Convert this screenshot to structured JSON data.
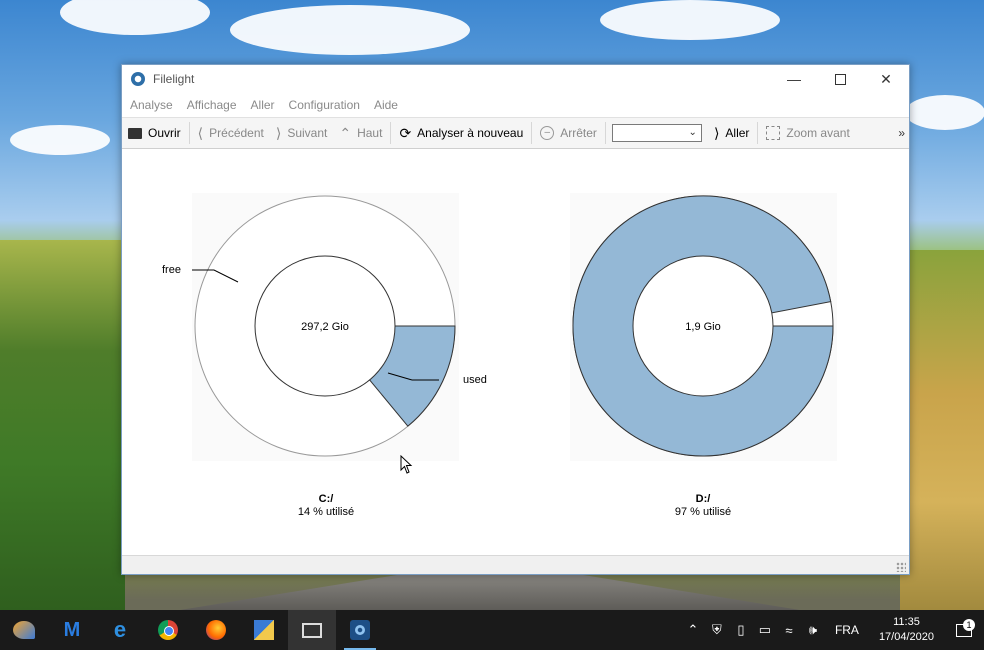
{
  "window": {
    "title": "Filelight"
  },
  "menu": [
    "Analyse",
    "Affichage",
    "Aller",
    "Configuration",
    "Aide"
  ],
  "toolbar": {
    "open": "Ouvrir",
    "back": "Précédent",
    "forward": "Suivant",
    "up": "Haut",
    "rescan": "Analyser à nouveau",
    "stop": "Arrêter",
    "location_value": "",
    "go": "Aller",
    "zoom_in": "Zoom avant",
    "more": "»"
  },
  "drives": [
    {
      "name": "C:/",
      "size": "297,2 Gio",
      "usage_text": "14 % utilisé",
      "used_fraction": 0.14,
      "labels": {
        "free": "free",
        "used": "used"
      }
    },
    {
      "name": "D:/",
      "size": "1,9 Gio",
      "usage_text": "97 % utilisé",
      "used_fraction": 0.97
    }
  ],
  "colors": {
    "used": "#94b8d6",
    "free": "#ffffff",
    "panel": "#fafafa",
    "accent": "#76b9ed"
  },
  "taskbar": {
    "apps": [
      "kde-app-icon",
      "malwarebytes-icon",
      "edge-icon",
      "chrome-icon",
      "firefox-icon",
      "tiles-app-icon",
      "display-app-icon",
      "filelight-icon"
    ],
    "language": "FRA",
    "time": "11:35",
    "date": "17/04/2020",
    "notification_count": "1"
  }
}
